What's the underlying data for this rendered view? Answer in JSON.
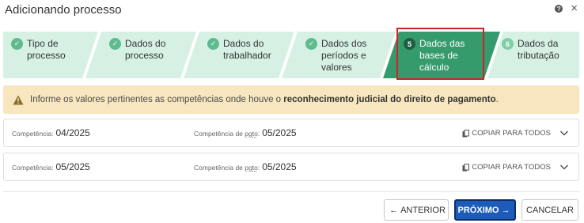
{
  "header": {
    "title": "Adicionando processo",
    "help_icon": "question-circle-icon",
    "close_icon": "close-icon"
  },
  "stepper": {
    "steps": [
      {
        "number": "1",
        "lines": [
          "Tipo de",
          "processo"
        ],
        "state": "done"
      },
      {
        "number": "2",
        "lines": [
          "Dados do",
          "processo"
        ],
        "state": "done"
      },
      {
        "number": "3",
        "lines": [
          "Dados do",
          "trabalhador"
        ],
        "state": "done"
      },
      {
        "number": "4",
        "lines": [
          "Dados dos",
          "períodos e",
          "valores"
        ],
        "state": "done"
      },
      {
        "number": "5",
        "lines": [
          "Dados das",
          "bases de",
          "cálculo"
        ],
        "state": "active"
      },
      {
        "number": "6",
        "lines": [
          "Dados da",
          "tributação"
        ],
        "state": "future"
      }
    ],
    "colors": {
      "done_bg": "#d6f1e4",
      "active_bg": "#359a6c",
      "future_bg": "#d6f1e4",
      "check": "#5dbb8e"
    }
  },
  "alert": {
    "text_before": "Informe os valores pertinentes as competências onde houve o ",
    "text_bold": "reconhecimento judicial do direito de pagamento",
    "text_after": ".",
    "bg": "#f8e7be"
  },
  "rows": [
    {
      "competencia_label": "Competência:",
      "competencia_value": "04/2025",
      "pgto_label_a": "Competência de ",
      "pgto_label_b": "pgto",
      "pgto_label_c": ":",
      "pgto_value": "05/2025",
      "copy_label": "COPIAR PARA TODOS"
    },
    {
      "competencia_label": "Competência:",
      "competencia_value": "05/2025",
      "pgto_label_a": "Competência de ",
      "pgto_label_b": "pgto",
      "pgto_label_c": ":",
      "pgto_value": "05/2025",
      "copy_label": "COPIAR PARA TODOS"
    }
  ],
  "footer": {
    "prev_label": "ANTERIOR",
    "next_label": "PRÓXIMO",
    "cancel_label": "CANCELAR",
    "next_color": "#1c5cb8"
  }
}
